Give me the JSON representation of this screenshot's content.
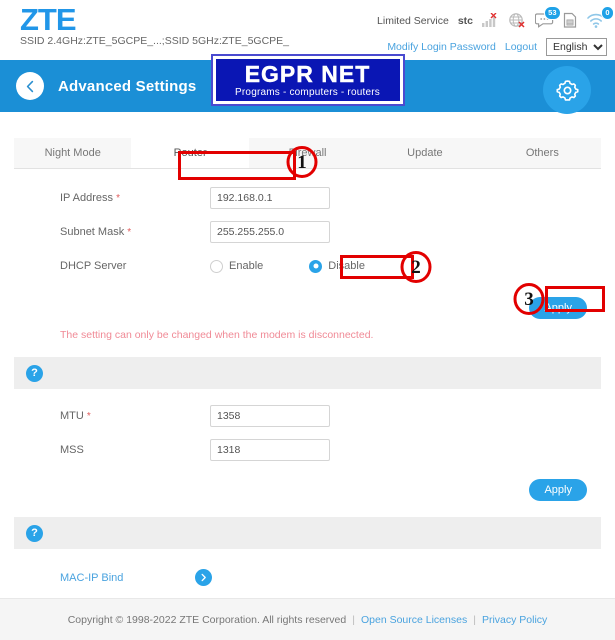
{
  "header": {
    "brand": "ZTE",
    "ssid_line": "SSID 2.4GHz:ZTE_5GCPE_...;SSID 5GHz:ZTE_5GCPE_",
    "service_status": "Limited Service",
    "carrier": "stc",
    "sms_badge": "53",
    "wifi_badge": "0",
    "modify_password_link": "Modify Login Password",
    "logout_link": "Logout",
    "language": "English",
    "language_options": [
      "English"
    ],
    "icons": [
      "signal-bars-error-icon",
      "globe-error-icon",
      "sms-icon",
      "sim-card-icon",
      "wifi-icon"
    ]
  },
  "banner": {
    "title": "Advanced Settings",
    "back_icon": "chevron-left-icon",
    "gear_icon": "gear-icon",
    "logo_title": "EGPR NET",
    "logo_subtitle": "Programs - computers - routers",
    "logo_bg": "#0a16b4",
    "banner_bg": "#1b8fd6"
  },
  "tabs": [
    {
      "label": "Night Mode",
      "active": false
    },
    {
      "label": "Router",
      "active": true
    },
    {
      "label": "Firewall",
      "active": false
    },
    {
      "label": "Update",
      "active": false
    },
    {
      "label": "Others",
      "active": false
    }
  ],
  "router_form": {
    "ip_address": {
      "label": "IP Address",
      "required": "*",
      "value": "192.168.0.1"
    },
    "subnet_mask": {
      "label": "Subnet Mask",
      "required": "*",
      "value": "255.255.255.0"
    },
    "dhcp_server": {
      "label": "DHCP Server",
      "enable_label": "Enable",
      "disable_label": "Disable",
      "selected": "Disable"
    },
    "apply_label": "Apply",
    "warning": "The setting can only be changed when the modem is disconnected."
  },
  "mtu_form": {
    "help_icon": "question-mark-icon",
    "mtu": {
      "label": "MTU",
      "required": "*",
      "value": "1358"
    },
    "mss": {
      "label": "MSS",
      "required": "",
      "value": "1318"
    },
    "apply_label": "Apply"
  },
  "macip_section": {
    "help_icon": "question-mark-icon",
    "link_label": "MAC-IP Bind",
    "chevron_icon": "chevron-right-icon"
  },
  "footer": {
    "copyright": "Copyright © 1998-2022 ZTE Corporation. All rights reserved",
    "separator": "|",
    "open_source_link": "Open Source Licenses",
    "privacy_link": "Privacy Policy"
  },
  "annotations": {
    "step1": "1",
    "step2": "2",
    "step3": "3",
    "highlight_color": "#e20000"
  }
}
